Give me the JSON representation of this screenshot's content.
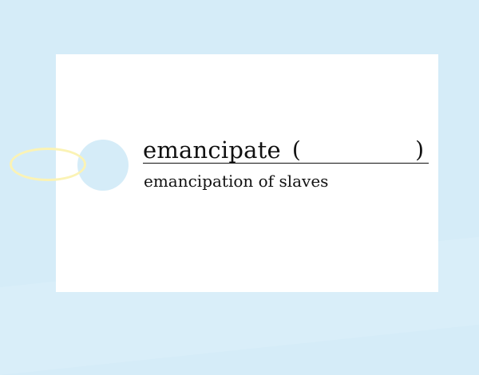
{
  "card": {
    "headword": "emancipate",
    "paren_open": "(",
    "paren_close": ")",
    "example": "emancipation of slaves"
  },
  "colors": {
    "background": "#d5ecf8",
    "card": "#ffffff",
    "hole": "#d5ecf8",
    "ring": "#fbf3b5",
    "text": "#111111"
  }
}
